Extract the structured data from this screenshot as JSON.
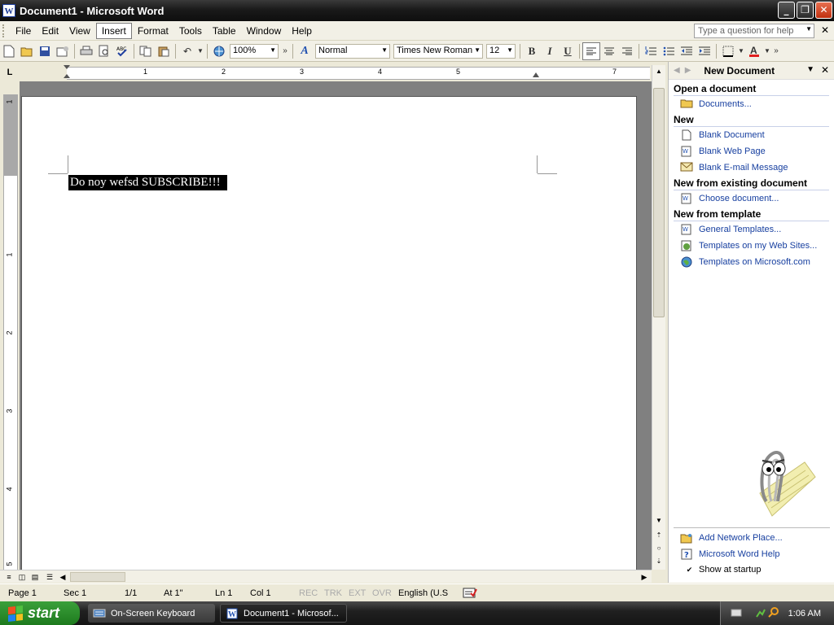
{
  "window": {
    "title": "Document1 - Microsoft Word",
    "app_icon": "W",
    "controls": {
      "minimize": "_",
      "restore": "❐",
      "close": "✕"
    }
  },
  "menubar": {
    "items": [
      "File",
      "Edit",
      "View",
      "Insert",
      "Format",
      "Tools",
      "Table",
      "Window",
      "Help"
    ],
    "active_item": "Insert",
    "help_placeholder": "Type a question for help",
    "close_glyph": "✕"
  },
  "toolbar": {
    "zoom": "100%",
    "style": "Normal",
    "font": "Times New Roman",
    "size": "12",
    "bold": "B",
    "italic": "I",
    "underline": "U",
    "icons": [
      "new-icon",
      "open-icon",
      "save-icon",
      "permission-icon",
      "print-icon",
      "print-preview-icon",
      "spelling-icon",
      "copy-icon",
      "paste-icon",
      "undo-icon",
      "web-icon"
    ]
  },
  "ruler": {
    "corner": "L",
    "h_numbers": [
      "1",
      "2",
      "3",
      "4",
      "5",
      "7"
    ],
    "v_numbers": [
      "1",
      "1",
      "2",
      "3",
      "4",
      "5"
    ]
  },
  "document": {
    "text": "Do noy wefsd SUBSCRIBE!!!"
  },
  "task_pane": {
    "title": "New Document",
    "sections": [
      {
        "heading": "Open a document",
        "links": [
          {
            "label": "Documents...",
            "icon": "folder-icon"
          }
        ]
      },
      {
        "heading": "New",
        "links": [
          {
            "label": "Blank Document",
            "icon": "blank-document-icon"
          },
          {
            "label": "Blank Web Page",
            "icon": "web-page-icon"
          },
          {
            "label": "Blank E-mail Message",
            "icon": "email-icon"
          }
        ]
      },
      {
        "heading": "New from existing document",
        "links": [
          {
            "label": "Choose document...",
            "icon": "document-icon"
          }
        ]
      },
      {
        "heading": "New from template",
        "links": [
          {
            "label": "General Templates...",
            "icon": "template-icon"
          },
          {
            "label": "Templates on my Web Sites...",
            "icon": "web-templates-icon"
          },
          {
            "label": "Templates on Microsoft.com",
            "icon": "globe-icon"
          }
        ]
      }
    ],
    "bottom_links": [
      {
        "label": "Add Network Place...",
        "icon": "network-place-icon"
      },
      {
        "label": "Microsoft Word Help",
        "icon": "help-icon"
      }
    ],
    "show_at_startup": "Show at startup",
    "show_at_startup_checked": true
  },
  "statusbar": {
    "page": "Page 1",
    "sec": "Sec 1",
    "pages": "1/1",
    "at": "At 1\"",
    "ln": "Ln 1",
    "col": "Col 1",
    "rec": "REC",
    "trk": "TRK",
    "ext": "EXT",
    "ovr": "OVR",
    "language": "English (U.S"
  },
  "taskbar": {
    "start": "start",
    "tasks": [
      {
        "label": "On-Screen Keyboard",
        "icon": "keyboard-icon",
        "active": false
      },
      {
        "label": "Document1 - Microsof...",
        "icon": "word-icon",
        "active": true
      }
    ],
    "clock": "1:06 AM"
  }
}
